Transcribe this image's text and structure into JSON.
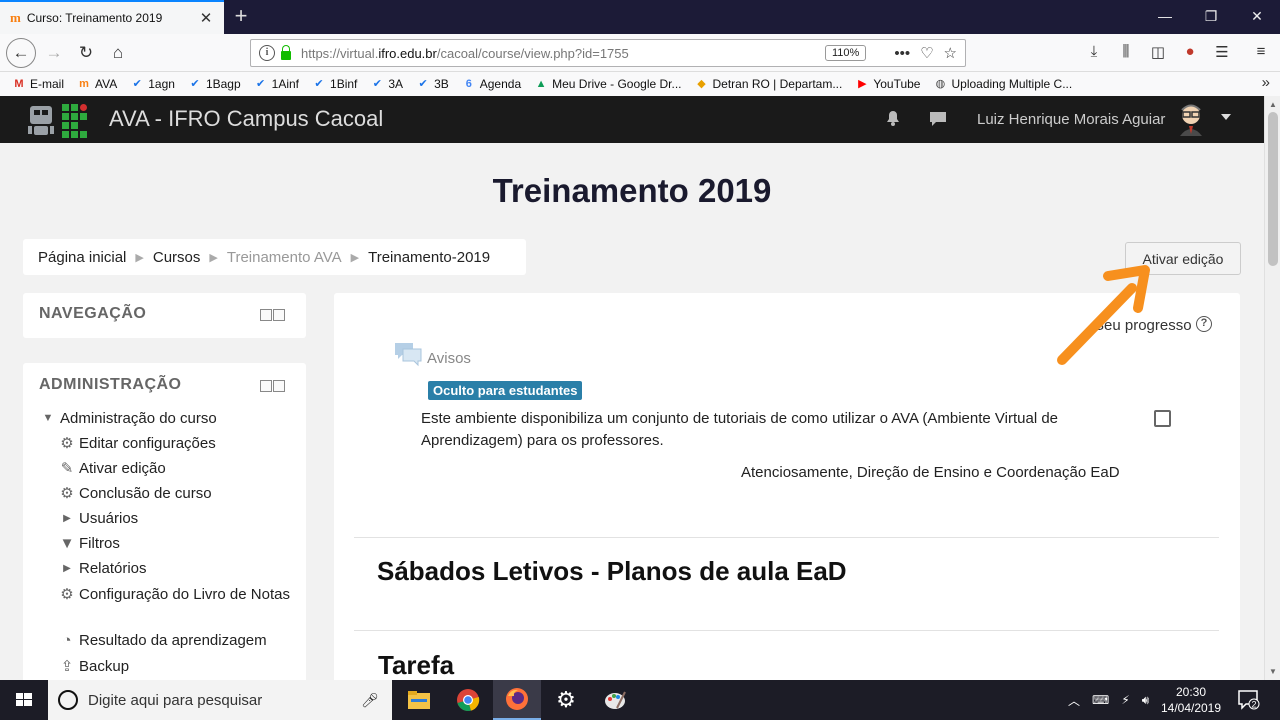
{
  "browser": {
    "tab_title": "Curso: Treinamento 2019",
    "tab_favicon": "m",
    "url_prefix": "https://virtual.",
    "url_domain": "ifro.edu.br",
    "url_path": "/cacoal/course/view.php?id=1755",
    "zoom": "110%"
  },
  "bookmarks": [
    {
      "label": "E-mail",
      "icon": "gmail-icon",
      "glyph": "M",
      "color": "#d93025"
    },
    {
      "label": "AVA",
      "icon": "moodle-icon",
      "glyph": "m",
      "color": "#f98012"
    },
    {
      "label": "1agn",
      "icon": "checklist-icon",
      "glyph": "✔",
      "color": "#1a73e8"
    },
    {
      "label": "1Bagp",
      "icon": "checklist-icon",
      "glyph": "✔",
      "color": "#1a73e8"
    },
    {
      "label": "1Ainf",
      "icon": "checklist-icon",
      "glyph": "✔",
      "color": "#1a73e8"
    },
    {
      "label": "1Binf",
      "icon": "checklist-icon",
      "glyph": "✔",
      "color": "#1a73e8"
    },
    {
      "label": "3A",
      "icon": "checklist-icon",
      "glyph": "✔",
      "color": "#1a73e8"
    },
    {
      "label": "3B",
      "icon": "checklist-icon",
      "glyph": "✔",
      "color": "#1a73e8"
    },
    {
      "label": "Agenda",
      "icon": "calendar-icon",
      "glyph": "6",
      "color": "#4285f4"
    },
    {
      "label": "Meu Drive - Google Dr...",
      "icon": "drive-icon",
      "glyph": "▲",
      "color": "#0f9d58"
    },
    {
      "label": "Detran RO | Departam...",
      "icon": "detran-icon",
      "glyph": "◆",
      "color": "#e8a000"
    },
    {
      "label": "YouTube",
      "icon": "youtube-icon",
      "glyph": "▶",
      "color": "#ff0000"
    },
    {
      "label": "Uploading Multiple C...",
      "icon": "globe-icon",
      "glyph": "◍",
      "color": "#444444"
    }
  ],
  "site": {
    "name": "AVA - IFRO Campus Cacoal",
    "user": "Luiz Henrique Morais Aguiar"
  },
  "page": {
    "title": "Treinamento 2019",
    "breadcrumb": [
      "Página inicial",
      "Cursos",
      "Treinamento AVA",
      "Treinamento-2019"
    ],
    "edit_button": "Ativar edição"
  },
  "nav_block": {
    "title": "NAVEGAÇÃO"
  },
  "admin_block": {
    "title": "ADMINISTRAÇÃO",
    "root": "Administração do curso",
    "items": [
      {
        "label": "Editar configurações",
        "icon": "gear-icon",
        "glyph": "⚙"
      },
      {
        "label": "Ativar edição",
        "icon": "pencil-icon",
        "glyph": "✎"
      },
      {
        "label": "Conclusão de curso",
        "icon": "gear-icon",
        "glyph": "⚙"
      },
      {
        "label": "Usuários",
        "icon": "chevron-right-icon",
        "glyph": "▶"
      },
      {
        "label": "Filtros",
        "icon": "filter-icon",
        "glyph": "▼"
      },
      {
        "label": "Relatórios",
        "icon": "chevron-right-icon",
        "glyph": "▶"
      },
      {
        "label": "Configuração do Livro de Notas",
        "icon": "gear-icon",
        "glyph": "⚙"
      },
      {
        "label": "Resultado da aprendizagem",
        "icon": "pie-chart-icon",
        "glyph": "◔"
      },
      {
        "label": "Backup",
        "icon": "upload-icon",
        "glyph": "⇪"
      }
    ]
  },
  "main": {
    "progress_label": "Seu progresso",
    "forum_name": "Avisos",
    "hidden_badge": "Oculto para estudantes",
    "description": "Este ambiente disponibiliza um conjunto de tutoriais de como utilizar o AVA (Ambiente Virtual de Aprendizagem) para os professores.",
    "signature": "Atenciosamente, Direção de Ensino e Coordenação EaD",
    "section1": "Sábados Letivos - Planos de aula EaD",
    "section2": "Tarefa"
  },
  "taskbar": {
    "search_placeholder": "Digite aqui para pesquisar",
    "time": "20:30",
    "date": "14/04/2019",
    "notifications": "2"
  },
  "colors": {
    "accent_orange": "#f7901e",
    "badge_blue": "#2a7fa8",
    "navbar": "#1a1a1a"
  }
}
